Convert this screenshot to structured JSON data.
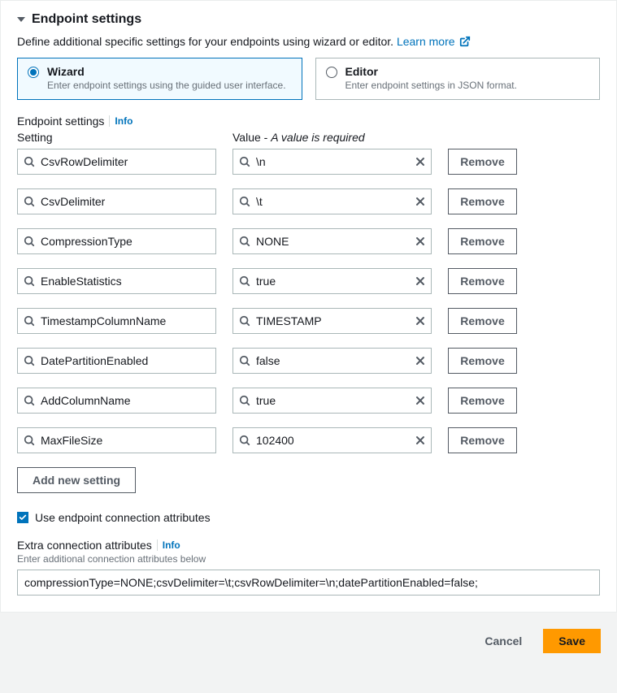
{
  "panel": {
    "title": "Endpoint settings",
    "description": "Define additional specific settings for your endpoints using wizard or editor.",
    "learn_more": "Learn more"
  },
  "mode": {
    "wizard": {
      "label": "Wizard",
      "desc": "Enter endpoint settings using the guided user interface."
    },
    "editor": {
      "label": "Editor",
      "desc": "Enter endpoint settings in JSON format."
    }
  },
  "settings_section": {
    "title": "Endpoint settings",
    "info": "Info",
    "setting_header": "Setting",
    "value_header_prefix": "Value - ",
    "value_header_required": "A value is required",
    "remove_label": "Remove",
    "add_new_label": "Add new setting",
    "rows": [
      {
        "setting": "CsvRowDelimiter",
        "value": "\\n"
      },
      {
        "setting": "CsvDelimiter",
        "value": "\\t"
      },
      {
        "setting": "CompressionType",
        "value": "NONE"
      },
      {
        "setting": "EnableStatistics",
        "value": "true"
      },
      {
        "setting": "TimestampColumnName",
        "value": "TIMESTAMP"
      },
      {
        "setting": "DatePartitionEnabled",
        "value": "false"
      },
      {
        "setting": "AddColumnName",
        "value": "true"
      },
      {
        "setting": "MaxFileSize",
        "value": "102400"
      }
    ]
  },
  "checkbox": {
    "label": "Use endpoint connection attributes"
  },
  "extra": {
    "title": "Extra connection attributes",
    "info": "Info",
    "desc": "Enter additional connection attributes below",
    "value": "compressionType=NONE;csvDelimiter=\\t;csvRowDelimiter=\\n;datePartitionEnabled=false;"
  },
  "footer": {
    "cancel": "Cancel",
    "save": "Save"
  }
}
